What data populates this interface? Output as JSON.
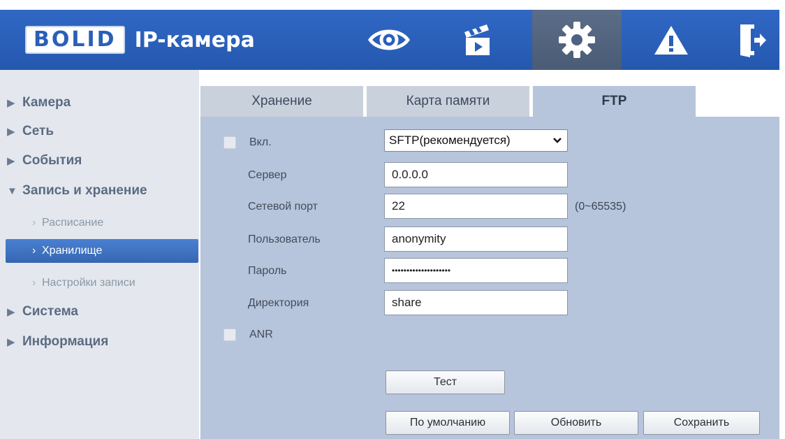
{
  "header": {
    "brand": "BOLID",
    "title": "IP-камера",
    "nav_icons": [
      "eye-icon",
      "clapperboard-icon",
      "gear-icon",
      "warning-icon",
      "exit-icon"
    ],
    "active_icon": "gear-icon",
    "colors": {
      "header_bg": "#2a5fb8",
      "active_bg": "#4a5b75"
    }
  },
  "sidebar": {
    "items": [
      {
        "label": "Камера",
        "expanded": false
      },
      {
        "label": "Сеть",
        "expanded": false
      },
      {
        "label": "События",
        "expanded": false
      },
      {
        "label": "Запись и хранение",
        "expanded": true,
        "children": [
          {
            "label": "Расписание",
            "active": false
          },
          {
            "label": "Хранилище",
            "active": true
          },
          {
            "label": "Настройки записи",
            "active": false
          }
        ]
      },
      {
        "label": "Система",
        "expanded": false
      },
      {
        "label": "Информация",
        "expanded": false
      }
    ]
  },
  "main": {
    "tabs": [
      {
        "label": "Хранение",
        "active": false
      },
      {
        "label": "Карта памяти",
        "active": false
      },
      {
        "label": "FTP",
        "active": true
      }
    ],
    "form": {
      "enable": {
        "label": "Вкл.",
        "checked": false
      },
      "protocol": {
        "value": "SFTP(рекомендуется)"
      },
      "server": {
        "label": "Сервер",
        "value": "0.0.0.0"
      },
      "port": {
        "label": "Сетевой порт",
        "value": "22",
        "range": "(0~65535)"
      },
      "user": {
        "label": "Пользователь",
        "value": "anonymity"
      },
      "password": {
        "label": "Пароль",
        "value": "••••••••••••••••••••"
      },
      "directory": {
        "label": "Директория",
        "value": "share"
      },
      "anr": {
        "label": "ANR",
        "checked": false
      }
    },
    "buttons": {
      "test": "Тест",
      "default": "По умолчанию",
      "refresh": "Обновить",
      "save": "Сохранить"
    }
  }
}
